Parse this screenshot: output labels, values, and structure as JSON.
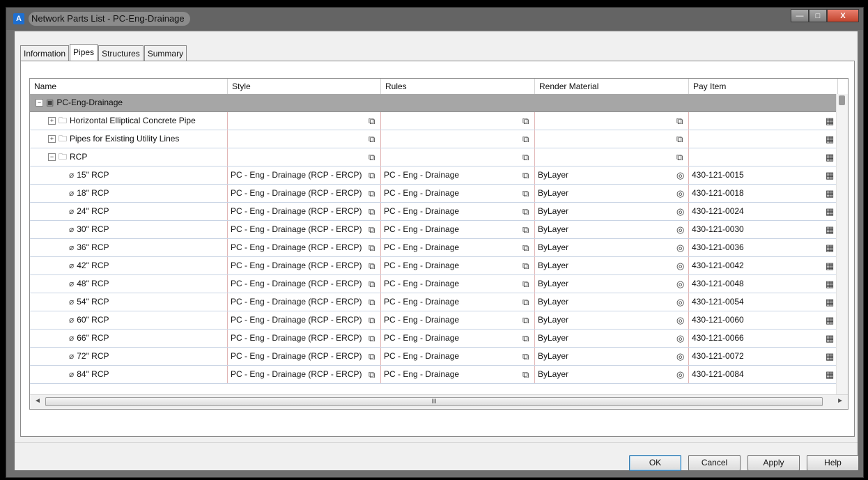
{
  "window": {
    "title": "Network Parts List - PC-Eng-Drainage",
    "minimize": "—",
    "maximize": "□",
    "close": "X"
  },
  "tabs": [
    "Information",
    "Pipes",
    "Structures",
    "Summary"
  ],
  "active_tab": "Pipes",
  "columns": [
    "Name",
    "Style",
    "Rules",
    "Render Material",
    "Pay Item"
  ],
  "tree": {
    "root": "PC-Eng-Drainage",
    "folders": [
      {
        "name": "Horizontal Elliptical Concrete Pipe",
        "expander": "+"
      },
      {
        "name": "Pipes for Existing Utility Lines",
        "expander": "+"
      },
      {
        "name": "RCP",
        "expander": "−"
      }
    ],
    "rcp_parts": [
      {
        "name": "15\" RCP",
        "style": "PC - Eng - Drainage (RCP - ERCP)",
        "rules": "PC - Eng - Drainage",
        "material": "ByLayer",
        "pay_item": "430-121-0015"
      },
      {
        "name": "18\" RCP",
        "style": "PC - Eng - Drainage (RCP - ERCP)",
        "rules": "PC - Eng - Drainage",
        "material": "ByLayer",
        "pay_item": "430-121-0018"
      },
      {
        "name": "24\" RCP",
        "style": "PC - Eng - Drainage (RCP - ERCP)",
        "rules": "PC - Eng - Drainage",
        "material": "ByLayer",
        "pay_item": "430-121-0024"
      },
      {
        "name": "30\" RCP",
        "style": "PC - Eng - Drainage (RCP - ERCP)",
        "rules": "PC - Eng - Drainage",
        "material": "ByLayer",
        "pay_item": "430-121-0030"
      },
      {
        "name": "36\" RCP",
        "style": "PC - Eng - Drainage (RCP - ERCP)",
        "rules": "PC - Eng - Drainage",
        "material": "ByLayer",
        "pay_item": "430-121-0036"
      },
      {
        "name": "42\" RCP",
        "style": "PC - Eng - Drainage (RCP - ERCP)",
        "rules": "PC - Eng - Drainage",
        "material": "ByLayer",
        "pay_item": "430-121-0042"
      },
      {
        "name": "48\" RCP",
        "style": "PC - Eng - Drainage (RCP - ERCP)",
        "rules": "PC - Eng - Drainage",
        "material": "ByLayer",
        "pay_item": "430-121-0048"
      },
      {
        "name": "54\" RCP",
        "style": "PC - Eng - Drainage (RCP - ERCP)",
        "rules": "PC - Eng - Drainage",
        "material": "ByLayer",
        "pay_item": "430-121-0054"
      },
      {
        "name": "60\" RCP",
        "style": "PC - Eng - Drainage (RCP - ERCP)",
        "rules": "PC - Eng - Drainage",
        "material": "ByLayer",
        "pay_item": "430-121-0060"
      },
      {
        "name": "66\" RCP",
        "style": "PC - Eng - Drainage (RCP - ERCP)",
        "rules": "PC - Eng - Drainage",
        "material": "ByLayer",
        "pay_item": "430-121-0066"
      },
      {
        "name": "72\" RCP",
        "style": "PC - Eng - Drainage (RCP - ERCP)",
        "rules": "PC - Eng - Drainage",
        "material": "ByLayer",
        "pay_item": "430-121-0072"
      },
      {
        "name": "84\" RCP",
        "style": "PC - Eng - Drainage (RCP - ERCP)",
        "rules": "PC - Eng - Drainage",
        "material": "ByLayer",
        "pay_item": "430-121-0084"
      }
    ]
  },
  "icons": {
    "folder": "folder-icon",
    "pipe": "pipe-icon",
    "style_pick": "style-picker-icon",
    "rules_pick": "rules-picker-icon",
    "material": "material-icon",
    "pay_item": "pay-item-icon",
    "edit": "edit-list-icon"
  },
  "scrollbar": {
    "grip": "III",
    "left": "◄",
    "right": "►"
  },
  "buttons": {
    "ok": "OK",
    "cancel": "Cancel",
    "apply": "Apply",
    "help": "Help"
  }
}
